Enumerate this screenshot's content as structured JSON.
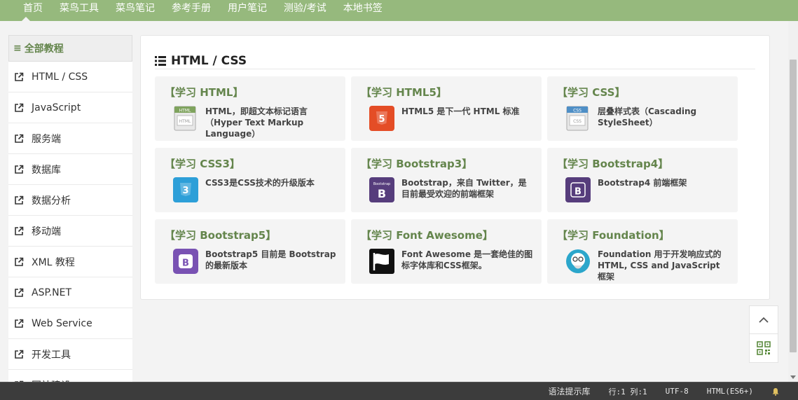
{
  "nav": {
    "items": [
      "首页",
      "菜鸟工具",
      "菜鸟笔记",
      "参考手册",
      "用户笔记",
      "测验/考试",
      "本地书签"
    ]
  },
  "sidebar": {
    "header": "全部教程",
    "items": [
      "HTML / CSS",
      "JavaScript",
      "服务端",
      "数据库",
      "数据分析",
      "移动端",
      "XML 教程",
      "ASP.NET",
      "Web Service",
      "开发工具",
      "网站建设"
    ]
  },
  "main": {
    "section_title": "HTML / CSS",
    "cards": [
      {
        "title": "【学习 HTML】",
        "desc": "HTML，即超文本标记语言（Hyper Text Markup Language）",
        "icon": "html-icon"
      },
      {
        "title": "【学习 HTML5】",
        "desc": "HTML5 是下一代 HTML 标准",
        "icon": "html5-icon"
      },
      {
        "title": "【学习 CSS】",
        "desc": "层叠样式表（Cascading StyleSheet）",
        "icon": "css-icon"
      },
      {
        "title": "【学习 CSS3】",
        "desc": "CSS3是CSS技术的升级版本",
        "icon": "css3-icon"
      },
      {
        "title": "【学习 Bootstrap3】",
        "desc": "Bootstrap，来自 Twitter，是目前最受欢迎的前端框架",
        "icon": "bootstrap3-icon"
      },
      {
        "title": "【学习 Bootstrap4】",
        "desc": "Bootstrap4 前端框架",
        "icon": "bootstrap4-icon"
      },
      {
        "title": "【学习 Bootstrap5】",
        "desc": "Bootstrap5 目前是 Bootstrap 的最新版本",
        "icon": "bootstrap5-icon"
      },
      {
        "title": "【学习 Font Awesome】",
        "desc": "Font Awesome 是一套绝佳的图标字体库和CSS框架。",
        "icon": "font-awesome-icon"
      },
      {
        "title": "【学习 Foundation】",
        "desc": "Foundation 用于开发响应式的 HTML, CSS and JavaScript 框架",
        "icon": "foundation-icon"
      }
    ]
  },
  "status": {
    "syntax": "语法提示库",
    "position": "行:1  列:1",
    "encoding": "UTF-8",
    "mode": "HTML(ES6+)"
  },
  "colors": {
    "nav_bg": "#96b97d",
    "accent_green": "#64854c",
    "html5_orange": "#e44d26",
    "css3_blue": "#2d9fd8",
    "bootstrap_purple": "#563d7c",
    "bootstrap5_purple": "#7952b3"
  }
}
